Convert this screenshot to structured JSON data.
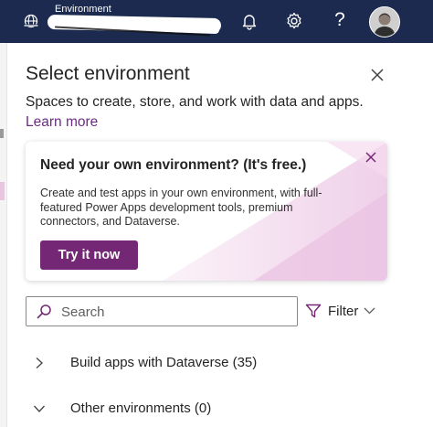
{
  "header": {
    "environment_label": "Environment",
    "icons": [
      "globe-icon",
      "bell-icon",
      "gear-icon",
      "help-icon",
      "avatar"
    ],
    "help_glyph": "?",
    "background_color": "#1b2a4e"
  },
  "panel": {
    "title": "Select environment",
    "subtitle": "Spaces to create, store, and work with data and apps.",
    "learn_more": "Learn more"
  },
  "promo": {
    "title": "Need your own environment? (It's free.)",
    "body": "Create and test apps in your own environment, with full-featured Power Apps development tools, premium connectors, and Dataverse.",
    "button": "Try it now",
    "accent_color": "#742774"
  },
  "search": {
    "placeholder": "Search",
    "value": ""
  },
  "filter": {
    "label": "Filter"
  },
  "groups": [
    {
      "label": "Build apps with Dataverse (35)",
      "state": "collapsed"
    },
    {
      "label": "Other environments (0)",
      "state": "expanded"
    }
  ]
}
